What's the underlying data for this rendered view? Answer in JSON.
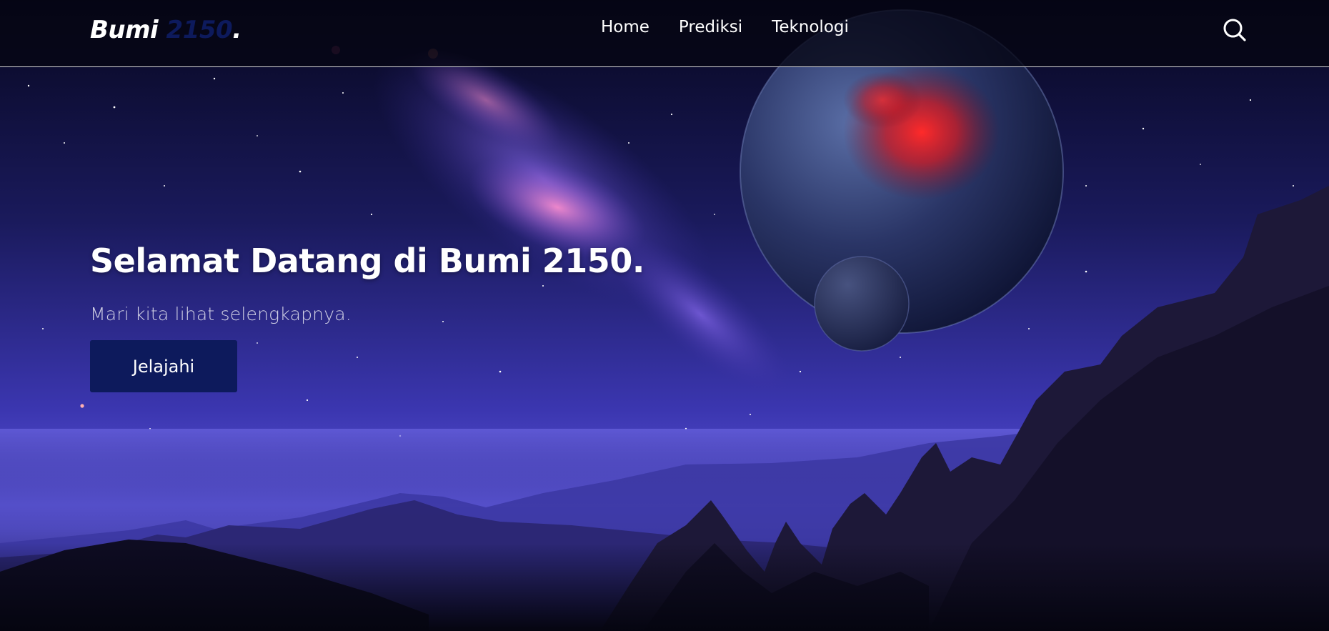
{
  "brand": {
    "name": "Bumi",
    "accent": "2150",
    "dot": "."
  },
  "nav": {
    "links": [
      "Home",
      "Prediksi",
      "Teknologi"
    ]
  },
  "search": {
    "icon": "search-icon"
  },
  "hero": {
    "title": "Selamat Datang di Bumi 2150.",
    "subtitle": "Mari kita lihat selengkapnya.",
    "cta_label": "Jelajahi"
  },
  "colors": {
    "accent": "#0d1a5c",
    "background": "#0a0a2e",
    "text": "#ffffff"
  }
}
